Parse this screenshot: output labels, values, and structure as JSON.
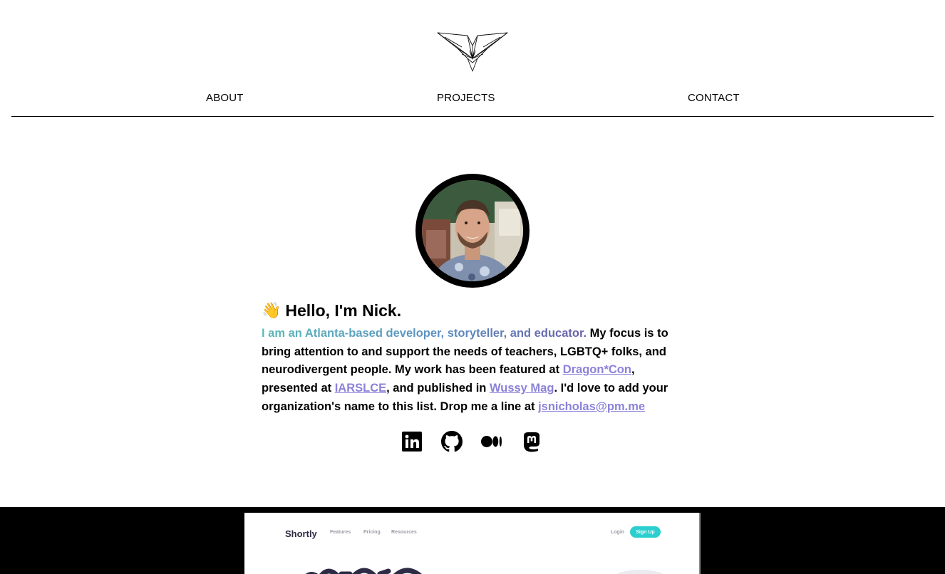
{
  "nav": {
    "about": "ABOUT",
    "projects": "PROJECTS",
    "contact": "CONTACT"
  },
  "logo": {
    "icon": "origami-crane-logo"
  },
  "intro": {
    "wave": "👋",
    "heading": "Hello, I'm Nick.",
    "tagline": "I am an Atlanta-based developer, storyteller, and educator.",
    "text1": " My focus is to bring attention to and support the needs of teachers, LGBTQ+ folks, and neurodivergent people. My work has been featured at ",
    "link1": "Dragon*Con",
    "text2": ", presented at ",
    "link2": "IARSLCE",
    "text3": ", and published in ",
    "link3": "Wussy Mag",
    "text4": ". I'd love to add your organization's name to this list. Drop me a line at ",
    "email": "jsnicholas@pm.me"
  },
  "social": [
    "linkedin-icon",
    "github-icon",
    "medium-icon",
    "mastodon-icon"
  ],
  "preview": {
    "brand": "Shortly",
    "features": "Features",
    "pricing": "Pricing",
    "resources": "Resources",
    "login": "Login",
    "signup": "Sign Up"
  },
  "colors": {
    "accent_link": "#8b82d9",
    "gradient_start": "#5bb8b8",
    "gradient_end": "#6a5fa8",
    "preview_cta": "#2acfcf"
  }
}
